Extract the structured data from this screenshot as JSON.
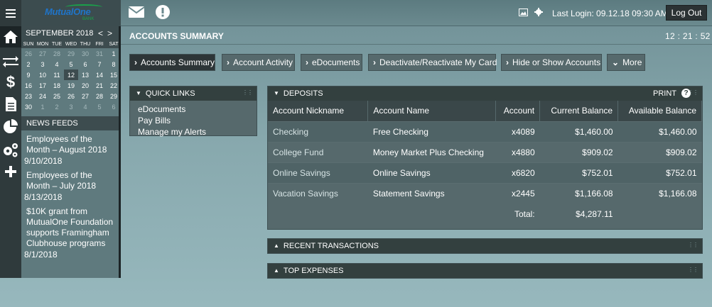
{
  "header": {
    "logo_text": "MutualOne",
    "logo_sub": "BANK",
    "last_login": "Last Login: 09.12.18 09:30 AM",
    "logout_label": "Log Out",
    "icons": [
      "mail-icon",
      "alert-icon",
      "picture-icon",
      "gear-icon"
    ]
  },
  "rail": [
    "home-icon",
    "transfer-icon",
    "dollar-icon",
    "document-icon",
    "pie-chart-icon",
    "settings-icon",
    "plus-icon"
  ],
  "calendar": {
    "month": "SEPTEMBER 2018",
    "prev": "<",
    "next": ">",
    "days_of_week": [
      "SUN",
      "MON",
      "TUE",
      "WED",
      "THU",
      "FRI",
      "SAT"
    ],
    "weeks": [
      [
        "26",
        "27",
        "28",
        "29",
        "30",
        "31",
        "1"
      ],
      [
        "2",
        "3",
        "4",
        "5",
        "6",
        "7",
        "8"
      ],
      [
        "9",
        "10",
        "11",
        "12",
        "13",
        "14",
        "15"
      ],
      [
        "16",
        "17",
        "18",
        "19",
        "20",
        "21",
        "22"
      ],
      [
        "23",
        "24",
        "25",
        "26",
        "27",
        "28",
        "29"
      ],
      [
        "30",
        "1",
        "2",
        "3",
        "4",
        "5",
        "6"
      ]
    ],
    "today": "12"
  },
  "news": {
    "title": "NEWS FEEDS",
    "items": [
      {
        "text": "Employees of the Month – August 2018",
        "date": "9/10/2018"
      },
      {
        "text": "Employees of the Month – July 2018",
        "date": "8/13/2018"
      },
      {
        "text": "$10K grant from MutualOne Foundation supports Framingham Clubhouse programs",
        "date": "8/1/2018"
      }
    ]
  },
  "page": {
    "title": "ACCOUNTS SUMMARY",
    "clock": "12 : 21 : 52"
  },
  "tabs": [
    {
      "label": "Accounts Summary"
    },
    {
      "label": "Account Activity"
    },
    {
      "label": "eDocuments"
    },
    {
      "label": "Deactivate/Reactivate My Card"
    },
    {
      "label": "Hide or Show Accounts"
    },
    {
      "label": "More"
    }
  ],
  "quick_links": {
    "title": "QUICK LINKS",
    "items": [
      "eDocuments",
      "Pay Bills",
      "Manage my Alerts"
    ]
  },
  "deposits": {
    "title": "DEPOSITS",
    "print_label": "PRINT",
    "help_label": "?",
    "columns": [
      "Account Nickname",
      "Account Name",
      "Account",
      "Current Balance",
      "Available Balance"
    ],
    "rows": [
      {
        "nickname": "Checking",
        "name": "Free Checking",
        "account": "x4089",
        "current": "$1,460.00",
        "available": "$1,460.00"
      },
      {
        "nickname": "College Fund",
        "name": "Money Market Plus Checking",
        "account": "x4880",
        "current": "$909.02",
        "available": "$909.02"
      },
      {
        "nickname": "Online Savings",
        "name": "Online Savings",
        "account": "x6820",
        "current": "$752.01",
        "available": "$752.01"
      },
      {
        "nickname": "Vacation Savings",
        "name": "Statement Savings",
        "account": "x2445",
        "current": "$1,166.08",
        "available": "$1,166.08"
      }
    ],
    "total_label": "Total:",
    "total_value": "$4,287.11"
  },
  "recent_transactions": {
    "title": "RECENT TRANSACTIONS"
  },
  "top_expenses": {
    "title": "TOP EXPENSES"
  }
}
